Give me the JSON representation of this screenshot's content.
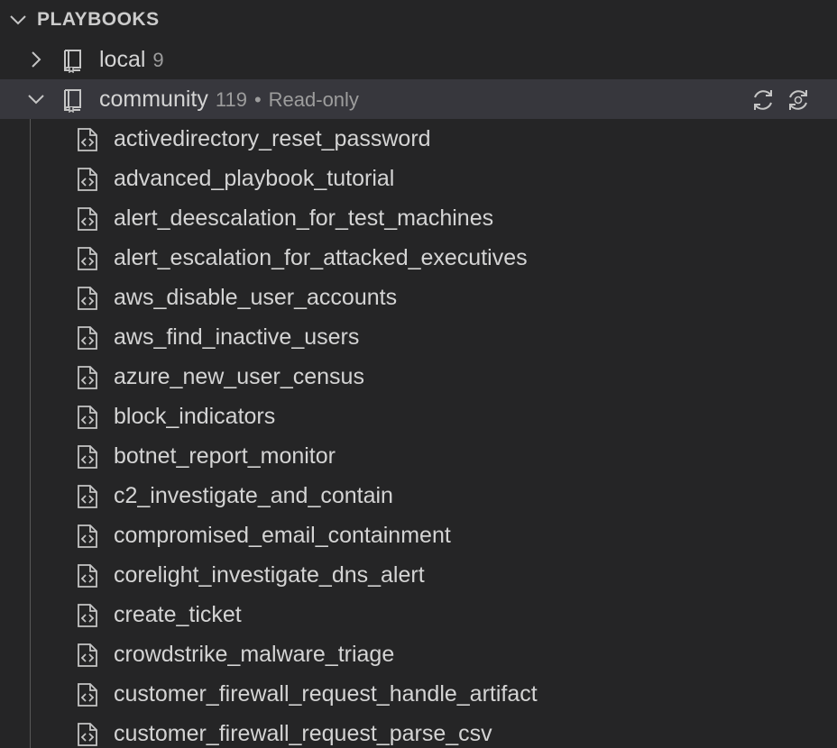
{
  "section": {
    "title": "PLAYBOOKS"
  },
  "groups": [
    {
      "label": "local",
      "count": "9",
      "expanded": false
    },
    {
      "label": "community",
      "count": "119",
      "separator": "•",
      "status": "Read-only",
      "expanded": true,
      "actions": [
        "refresh-icon",
        "sync-icon"
      ]
    }
  ],
  "files": [
    "activedirectory_reset_password",
    "advanced_playbook_tutorial",
    "alert_deescalation_for_test_machines",
    "alert_escalation_for_attacked_executives",
    "aws_disable_user_accounts",
    "aws_find_inactive_users",
    "azure_new_user_census",
    "block_indicators",
    "botnet_report_monitor",
    "c2_investigate_and_contain",
    "compromised_email_containment",
    "corelight_investigate_dns_alert",
    "create_ticket",
    "crowdstrike_malware_triage",
    "customer_firewall_request_handle_artifact",
    "customer_firewall_request_parse_csv"
  ],
  "colors": {
    "background": "#252526",
    "selected_row": "#37373d",
    "text": "#d4d4d4",
    "muted_text": "#9d9d9d"
  }
}
